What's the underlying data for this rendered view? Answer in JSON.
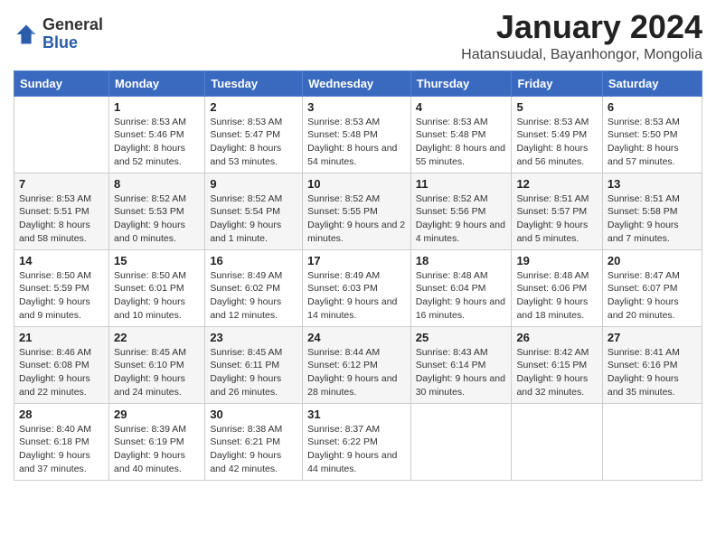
{
  "header": {
    "logo_general": "General",
    "logo_blue": "Blue",
    "month_title": "January 2024",
    "location": "Hatansuudal, Bayanhongor, Mongolia"
  },
  "weekdays": [
    "Sunday",
    "Monday",
    "Tuesday",
    "Wednesday",
    "Thursday",
    "Friday",
    "Saturday"
  ],
  "weeks": [
    [
      {
        "day": "",
        "sunrise": "",
        "sunset": "",
        "daylight": ""
      },
      {
        "day": "1",
        "sunrise": "Sunrise: 8:53 AM",
        "sunset": "Sunset: 5:46 PM",
        "daylight": "Daylight: 8 hours and 52 minutes."
      },
      {
        "day": "2",
        "sunrise": "Sunrise: 8:53 AM",
        "sunset": "Sunset: 5:47 PM",
        "daylight": "Daylight: 8 hours and 53 minutes."
      },
      {
        "day": "3",
        "sunrise": "Sunrise: 8:53 AM",
        "sunset": "Sunset: 5:48 PM",
        "daylight": "Daylight: 8 hours and 54 minutes."
      },
      {
        "day": "4",
        "sunrise": "Sunrise: 8:53 AM",
        "sunset": "Sunset: 5:48 PM",
        "daylight": "Daylight: 8 hours and 55 minutes."
      },
      {
        "day": "5",
        "sunrise": "Sunrise: 8:53 AM",
        "sunset": "Sunset: 5:49 PM",
        "daylight": "Daylight: 8 hours and 56 minutes."
      },
      {
        "day": "6",
        "sunrise": "Sunrise: 8:53 AM",
        "sunset": "Sunset: 5:50 PM",
        "daylight": "Daylight: 8 hours and 57 minutes."
      }
    ],
    [
      {
        "day": "7",
        "sunrise": "Sunrise: 8:53 AM",
        "sunset": "Sunset: 5:51 PM",
        "daylight": "Daylight: 8 hours and 58 minutes."
      },
      {
        "day": "8",
        "sunrise": "Sunrise: 8:52 AM",
        "sunset": "Sunset: 5:53 PM",
        "daylight": "Daylight: 9 hours and 0 minutes."
      },
      {
        "day": "9",
        "sunrise": "Sunrise: 8:52 AM",
        "sunset": "Sunset: 5:54 PM",
        "daylight": "Daylight: 9 hours and 1 minute."
      },
      {
        "day": "10",
        "sunrise": "Sunrise: 8:52 AM",
        "sunset": "Sunset: 5:55 PM",
        "daylight": "Daylight: 9 hours and 2 minutes."
      },
      {
        "day": "11",
        "sunrise": "Sunrise: 8:52 AM",
        "sunset": "Sunset: 5:56 PM",
        "daylight": "Daylight: 9 hours and 4 minutes."
      },
      {
        "day": "12",
        "sunrise": "Sunrise: 8:51 AM",
        "sunset": "Sunset: 5:57 PM",
        "daylight": "Daylight: 9 hours and 5 minutes."
      },
      {
        "day": "13",
        "sunrise": "Sunrise: 8:51 AM",
        "sunset": "Sunset: 5:58 PM",
        "daylight": "Daylight: 9 hours and 7 minutes."
      }
    ],
    [
      {
        "day": "14",
        "sunrise": "Sunrise: 8:50 AM",
        "sunset": "Sunset: 5:59 PM",
        "daylight": "Daylight: 9 hours and 9 minutes."
      },
      {
        "day": "15",
        "sunrise": "Sunrise: 8:50 AM",
        "sunset": "Sunset: 6:01 PM",
        "daylight": "Daylight: 9 hours and 10 minutes."
      },
      {
        "day": "16",
        "sunrise": "Sunrise: 8:49 AM",
        "sunset": "Sunset: 6:02 PM",
        "daylight": "Daylight: 9 hours and 12 minutes."
      },
      {
        "day": "17",
        "sunrise": "Sunrise: 8:49 AM",
        "sunset": "Sunset: 6:03 PM",
        "daylight": "Daylight: 9 hours and 14 minutes."
      },
      {
        "day": "18",
        "sunrise": "Sunrise: 8:48 AM",
        "sunset": "Sunset: 6:04 PM",
        "daylight": "Daylight: 9 hours and 16 minutes."
      },
      {
        "day": "19",
        "sunrise": "Sunrise: 8:48 AM",
        "sunset": "Sunset: 6:06 PM",
        "daylight": "Daylight: 9 hours and 18 minutes."
      },
      {
        "day": "20",
        "sunrise": "Sunrise: 8:47 AM",
        "sunset": "Sunset: 6:07 PM",
        "daylight": "Daylight: 9 hours and 20 minutes."
      }
    ],
    [
      {
        "day": "21",
        "sunrise": "Sunrise: 8:46 AM",
        "sunset": "Sunset: 6:08 PM",
        "daylight": "Daylight: 9 hours and 22 minutes."
      },
      {
        "day": "22",
        "sunrise": "Sunrise: 8:45 AM",
        "sunset": "Sunset: 6:10 PM",
        "daylight": "Daylight: 9 hours and 24 minutes."
      },
      {
        "day": "23",
        "sunrise": "Sunrise: 8:45 AM",
        "sunset": "Sunset: 6:11 PM",
        "daylight": "Daylight: 9 hours and 26 minutes."
      },
      {
        "day": "24",
        "sunrise": "Sunrise: 8:44 AM",
        "sunset": "Sunset: 6:12 PM",
        "daylight": "Daylight: 9 hours and 28 minutes."
      },
      {
        "day": "25",
        "sunrise": "Sunrise: 8:43 AM",
        "sunset": "Sunset: 6:14 PM",
        "daylight": "Daylight: 9 hours and 30 minutes."
      },
      {
        "day": "26",
        "sunrise": "Sunrise: 8:42 AM",
        "sunset": "Sunset: 6:15 PM",
        "daylight": "Daylight: 9 hours and 32 minutes."
      },
      {
        "day": "27",
        "sunrise": "Sunrise: 8:41 AM",
        "sunset": "Sunset: 6:16 PM",
        "daylight": "Daylight: 9 hours and 35 minutes."
      }
    ],
    [
      {
        "day": "28",
        "sunrise": "Sunrise: 8:40 AM",
        "sunset": "Sunset: 6:18 PM",
        "daylight": "Daylight: 9 hours and 37 minutes."
      },
      {
        "day": "29",
        "sunrise": "Sunrise: 8:39 AM",
        "sunset": "Sunset: 6:19 PM",
        "daylight": "Daylight: 9 hours and 40 minutes."
      },
      {
        "day": "30",
        "sunrise": "Sunrise: 8:38 AM",
        "sunset": "Sunset: 6:21 PM",
        "daylight": "Daylight: 9 hours and 42 minutes."
      },
      {
        "day": "31",
        "sunrise": "Sunrise: 8:37 AM",
        "sunset": "Sunset: 6:22 PM",
        "daylight": "Daylight: 9 hours and 44 minutes."
      },
      {
        "day": "",
        "sunrise": "",
        "sunset": "",
        "daylight": ""
      },
      {
        "day": "",
        "sunrise": "",
        "sunset": "",
        "daylight": ""
      },
      {
        "day": "",
        "sunrise": "",
        "sunset": "",
        "daylight": ""
      }
    ]
  ]
}
